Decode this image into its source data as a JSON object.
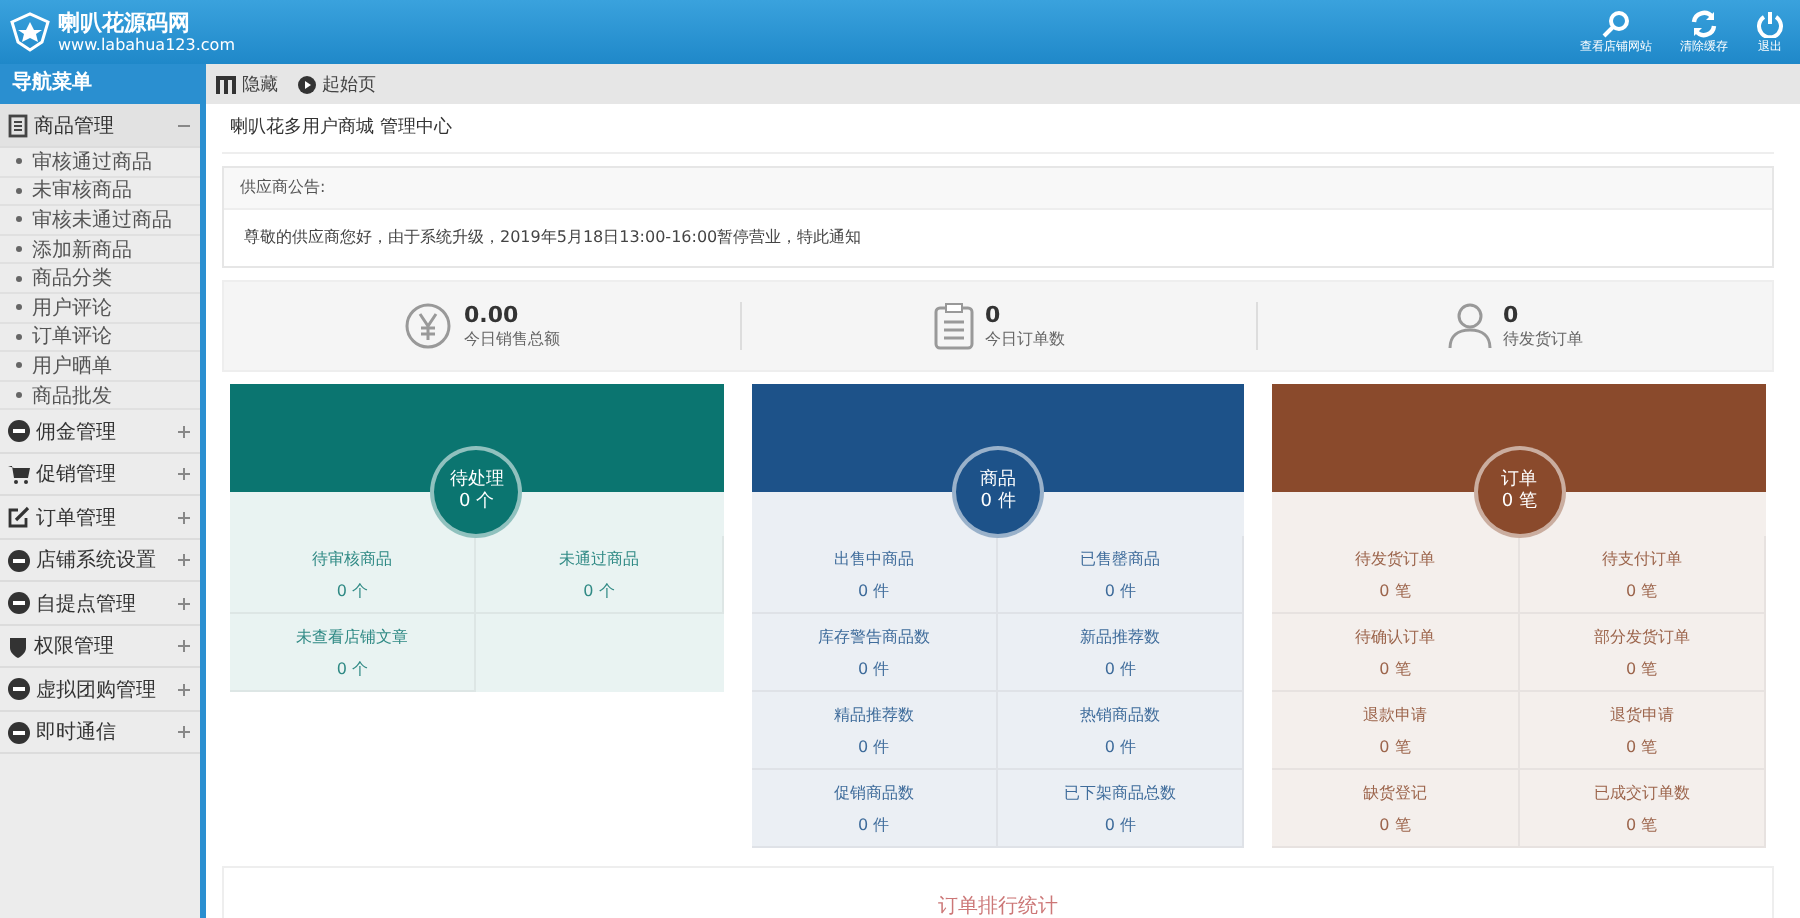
{
  "header": {
    "logo_title": "喇叭花源码网",
    "logo_url": "www.labahua123.com",
    "actions": [
      {
        "label": "查看店铺网站"
      },
      {
        "label": "清除缓存"
      },
      {
        "label": "退出"
      }
    ]
  },
  "sidebar": {
    "title": "导航菜单",
    "groups": [
      {
        "label": "商品管理",
        "expanded": true,
        "children": [
          "审核通过商品",
          "未审核商品",
          "审核未通过商品",
          "添加新商品",
          "商品分类",
          "用户评论",
          "订单评论",
          "用户晒单",
          "商品批发"
        ]
      },
      {
        "label": "佣金管理",
        "expanded": false
      },
      {
        "label": "促销管理",
        "expanded": false
      },
      {
        "label": "订单管理",
        "expanded": false
      },
      {
        "label": "店铺系统设置",
        "expanded": false
      },
      {
        "label": "自提点管理",
        "expanded": false
      },
      {
        "label": "权限管理",
        "expanded": false
      },
      {
        "label": "虚拟团购管理",
        "expanded": false
      },
      {
        "label": "即时通信",
        "expanded": false
      }
    ]
  },
  "toolbar": [
    {
      "label": "隐藏"
    },
    {
      "label": "起始页"
    }
  ],
  "page_title": "喇叭花多用户商城 管理中心",
  "notice": {
    "heading": "供应商公告:",
    "text": "尊敬的供应商您好，由于系统升级，2019年5月18日13:00-16:00暂停营业，特此通知"
  },
  "stats": [
    {
      "value": "0.00",
      "label": "今日销售总额"
    },
    {
      "value": "0",
      "label": "今日订单数"
    },
    {
      "value": "0",
      "label": "待发货订单"
    }
  ],
  "panels": [
    {
      "title": "待处理",
      "count": "0 个",
      "color": "#0b7570",
      "cells": [
        {
          "label": "待审核商品",
          "value": "0 个"
        },
        {
          "label": "未通过商品",
          "value": "0 个"
        },
        {
          "label": "未查看店铺文章",
          "value": "0 个"
        }
      ]
    },
    {
      "title": "商品",
      "count": "0 件",
      "color": "#1d5289",
      "cells": [
        {
          "label": "出售中商品",
          "value": "0 件"
        },
        {
          "label": "已售罄商品",
          "value": "0 件"
        },
        {
          "label": "库存警告商品数",
          "value": "0 件"
        },
        {
          "label": "新品推荐数",
          "value": "0 件"
        },
        {
          "label": "精品推荐数",
          "value": "0 件"
        },
        {
          "label": "热销商品数",
          "value": "0 件"
        },
        {
          "label": "促销商品数",
          "value": "0 件"
        },
        {
          "label": "已下架商品总数",
          "value": "0 件"
        }
      ]
    },
    {
      "title": "订单",
      "count": "0 笔",
      "color": "#8a4a2c",
      "cells": [
        {
          "label": "待发货订单",
          "value": "0 笔"
        },
        {
          "label": "待支付订单",
          "value": "0 笔"
        },
        {
          "label": "待确认订单",
          "value": "0 笔"
        },
        {
          "label": "部分发货订单",
          "value": "0 笔"
        },
        {
          "label": "退款申请",
          "value": "0 笔"
        },
        {
          "label": "退货申请",
          "value": "0 笔"
        },
        {
          "label": "缺货登记",
          "value": "0 笔"
        },
        {
          "label": "已成交订单数",
          "value": "0 笔"
        }
      ]
    }
  ],
  "chart_card": {
    "title": "订单排行统计"
  }
}
